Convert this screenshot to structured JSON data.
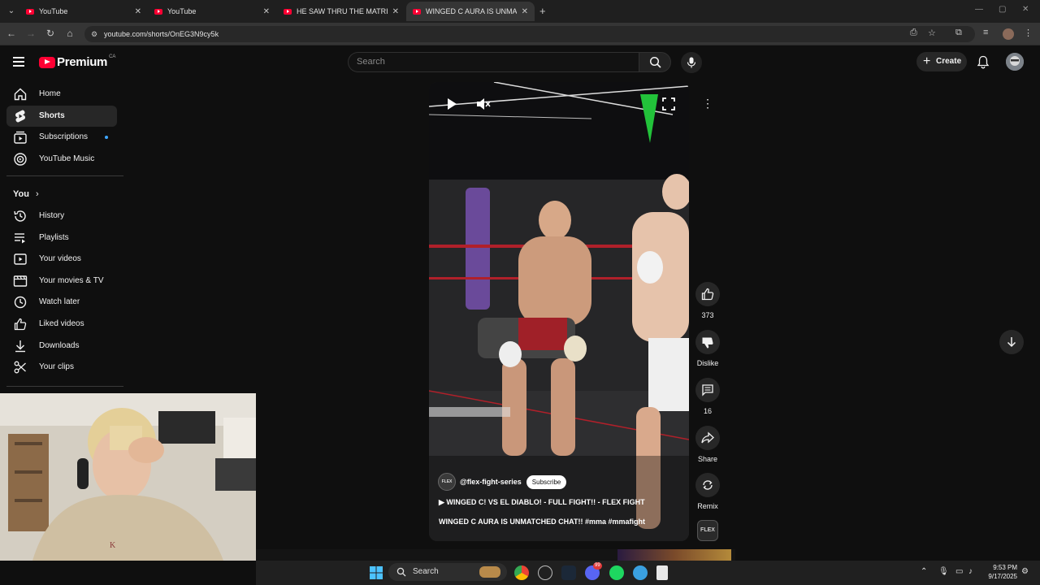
{
  "browser": {
    "tabs": [
      {
        "title": "YouTube",
        "active": false
      },
      {
        "title": "YouTube",
        "active": false
      },
      {
        "title": "HE SAW THRU THE MATRIX?? -",
        "active": false
      },
      {
        "title": "WINGED C AURA IS UNMATCH",
        "active": true
      }
    ],
    "url": "youtube.com/shorts/OnEG3N9cy5k"
  },
  "header": {
    "logo_text": "Premium",
    "country_code": "CA",
    "search_placeholder": "Search",
    "create_label": "Create"
  },
  "sidebar": {
    "main": [
      {
        "label": "Home",
        "icon": "home-icon"
      },
      {
        "label": "Shorts",
        "icon": "shorts-icon",
        "active": true
      },
      {
        "label": "Subscriptions",
        "icon": "subscriptions-icon"
      },
      {
        "label": "YouTube Music",
        "icon": "youtube-music-icon"
      }
    ],
    "you_label": "You",
    "you_items": [
      {
        "label": "History",
        "icon": "history-icon"
      },
      {
        "label": "Playlists",
        "icon": "playlists-icon"
      },
      {
        "label": "Your videos",
        "icon": "your-videos-icon"
      },
      {
        "label": "Your movies & TV",
        "icon": "movies-tv-icon"
      },
      {
        "label": "Watch later",
        "icon": "watch-later-icon"
      },
      {
        "label": "Liked videos",
        "icon": "liked-videos-icon"
      },
      {
        "label": "Downloads",
        "icon": "downloads-icon"
      },
      {
        "label": "Your clips",
        "icon": "clips-icon"
      }
    ]
  },
  "short": {
    "channel": "@flex-fight-series",
    "channel_avatar_text": "FLEX",
    "subscribe_label": "Subscribe",
    "linked_video": "WINGED C! VS EL DIABLO! - FULL FIGHT!! - FLEX FIGHT",
    "title": "WINGED C AURA IS UNMATCHED CHAT!! #mma #mmafight",
    "likes": "373",
    "dislike_label": "Dislike",
    "comments": "16",
    "share_label": "Share",
    "remix_label": "Remix"
  },
  "taskbar": {
    "search_label": "Search",
    "time": "9:53 PM",
    "date": "9/17/2025",
    "discord_badge": "99"
  },
  "colors": {
    "background": "#0f0f0f",
    "youtube_red": "#ff0033",
    "chrome_tabbar": "#1f1f1f",
    "subscriptions_dot": "#3ea6ff"
  }
}
